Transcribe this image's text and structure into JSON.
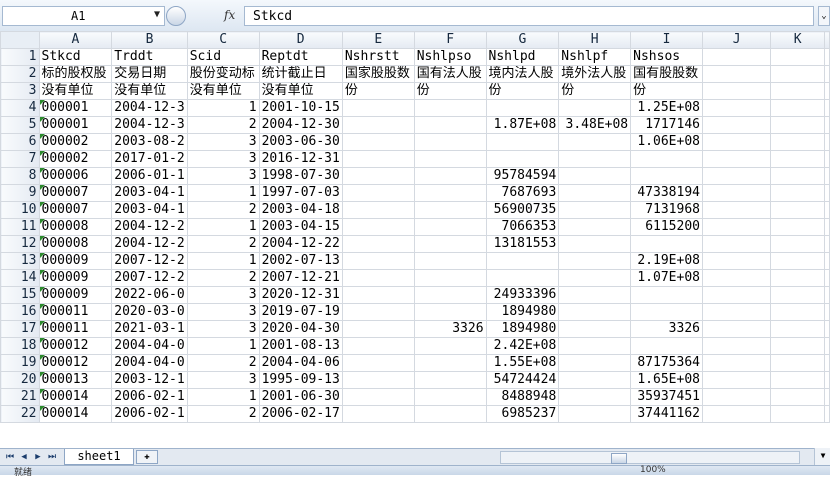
{
  "formula_bar": {
    "name_box": "A1",
    "name_box_arrow": "▼",
    "fx_label": "fx",
    "content": "Stkcd",
    "expand_icon": "chevron-double-down-icon"
  },
  "columns": [
    "A",
    "B",
    "C",
    "D",
    "E",
    "F",
    "G",
    "H",
    "I",
    "J",
    "K"
  ],
  "rows": [
    {
      "n": "1",
      "cells": [
        "Stkcd",
        "Trddt",
        "Scid",
        "Reptdt",
        "Nshrstt",
        "Nshlpso",
        "Nshlpd",
        "Nshlpf",
        "Nshsos",
        "",
        ""
      ]
    },
    {
      "n": "2",
      "cells": [
        "标的股权股",
        "交易日期",
        "股份变动标",
        "统计截止日",
        "国家股股数",
        "国有法人股",
        "境内法人股",
        "境外法人股",
        "国有股股数",
        "",
        ""
      ]
    },
    {
      "n": "3",
      "cells": [
        "没有单位",
        "没有单位",
        "没有单位",
        "没有单位",
        "份",
        "份",
        "份",
        "份",
        "份",
        "",
        ""
      ]
    },
    {
      "n": "4",
      "cells": [
        "000001",
        "2004-12-3",
        "1",
        "2001-10-15",
        "",
        "",
        "",
        "",
        "1.25E+08",
        "",
        ""
      ]
    },
    {
      "n": "5",
      "cells": [
        "000001",
        "2004-12-3",
        "2",
        "2004-12-30",
        "",
        "",
        "1.87E+08",
        "3.48E+08",
        "1717146",
        "",
        ""
      ]
    },
    {
      "n": "6",
      "cells": [
        "000002",
        "2003-08-2",
        "3",
        "2003-06-30",
        "",
        "",
        "",
        "",
        "1.06E+08",
        "",
        ""
      ]
    },
    {
      "n": "7",
      "cells": [
        "000002",
        "2017-01-2",
        "3",
        "2016-12-31",
        "",
        "",
        "",
        "",
        "",
        "",
        ""
      ]
    },
    {
      "n": "8",
      "cells": [
        "000006",
        "2006-01-1",
        "3",
        "1998-07-30",
        "",
        "",
        "95784594",
        "",
        "",
        "",
        ""
      ]
    },
    {
      "n": "9",
      "cells": [
        "000007",
        "2003-04-1",
        "1",
        "1997-07-03",
        "",
        "",
        "7687693",
        "",
        "47338194",
        "",
        ""
      ]
    },
    {
      "n": "10",
      "cells": [
        "000007",
        "2003-04-1",
        "2",
        "2003-04-18",
        "",
        "",
        "56900735",
        "",
        "7131968",
        "",
        ""
      ]
    },
    {
      "n": "11",
      "cells": [
        "000008",
        "2004-12-2",
        "1",
        "2003-04-15",
        "",
        "",
        "7066353",
        "",
        "6115200",
        "",
        ""
      ]
    },
    {
      "n": "12",
      "cells": [
        "000008",
        "2004-12-2",
        "2",
        "2004-12-22",
        "",
        "",
        "13181553",
        "",
        "",
        "",
        ""
      ]
    },
    {
      "n": "13",
      "cells": [
        "000009",
        "2007-12-2",
        "1",
        "2002-07-13",
        "",
        "",
        "",
        "",
        "2.19E+08",
        "",
        ""
      ]
    },
    {
      "n": "14",
      "cells": [
        "000009",
        "2007-12-2",
        "2",
        "2007-12-21",
        "",
        "",
        "",
        "",
        "1.07E+08",
        "",
        ""
      ]
    },
    {
      "n": "15",
      "cells": [
        "000009",
        "2022-06-0",
        "3",
        "2020-12-31",
        "",
        "",
        "24933396",
        "",
        "",
        "",
        ""
      ]
    },
    {
      "n": "16",
      "cells": [
        "000011",
        "2020-03-0",
        "3",
        "2019-07-19",
        "",
        "",
        "1894980",
        "",
        "",
        "",
        ""
      ]
    },
    {
      "n": "17",
      "cells": [
        "000011",
        "2021-03-1",
        "3",
        "2020-04-30",
        "",
        "3326",
        "1894980",
        "",
        "3326",
        "",
        ""
      ]
    },
    {
      "n": "18",
      "cells": [
        "000012",
        "2004-04-0",
        "1",
        "2001-08-13",
        "",
        "",
        "2.42E+08",
        "",
        "",
        "",
        ""
      ]
    },
    {
      "n": "19",
      "cells": [
        "000012",
        "2004-04-0",
        "2",
        "2004-04-06",
        "",
        "",
        "1.55E+08",
        "",
        "87175364",
        "",
        ""
      ]
    },
    {
      "n": "20",
      "cells": [
        "000013",
        "2003-12-1",
        "3",
        "1995-09-13",
        "",
        "",
        "54724424",
        "",
        "1.65E+08",
        "",
        ""
      ]
    },
    {
      "n": "21",
      "cells": [
        "000014",
        "2006-02-1",
        "1",
        "2001-06-30",
        "",
        "",
        "8488948",
        "",
        "35937451",
        "",
        ""
      ]
    },
    {
      "n": "22",
      "cells": [
        "000014",
        "2006-02-1",
        "2",
        "2006-02-17",
        "",
        "",
        "6985237",
        "",
        "37441162",
        "",
        ""
      ]
    }
  ],
  "sheet_tabs": [
    "sheet1"
  ],
  "nav_icons": [
    "first-sheet-icon",
    "prev-sheet-icon",
    "next-sheet-icon",
    "last-sheet-icon"
  ],
  "status": {
    "left": "就绪",
    "zoom": "100%"
  }
}
